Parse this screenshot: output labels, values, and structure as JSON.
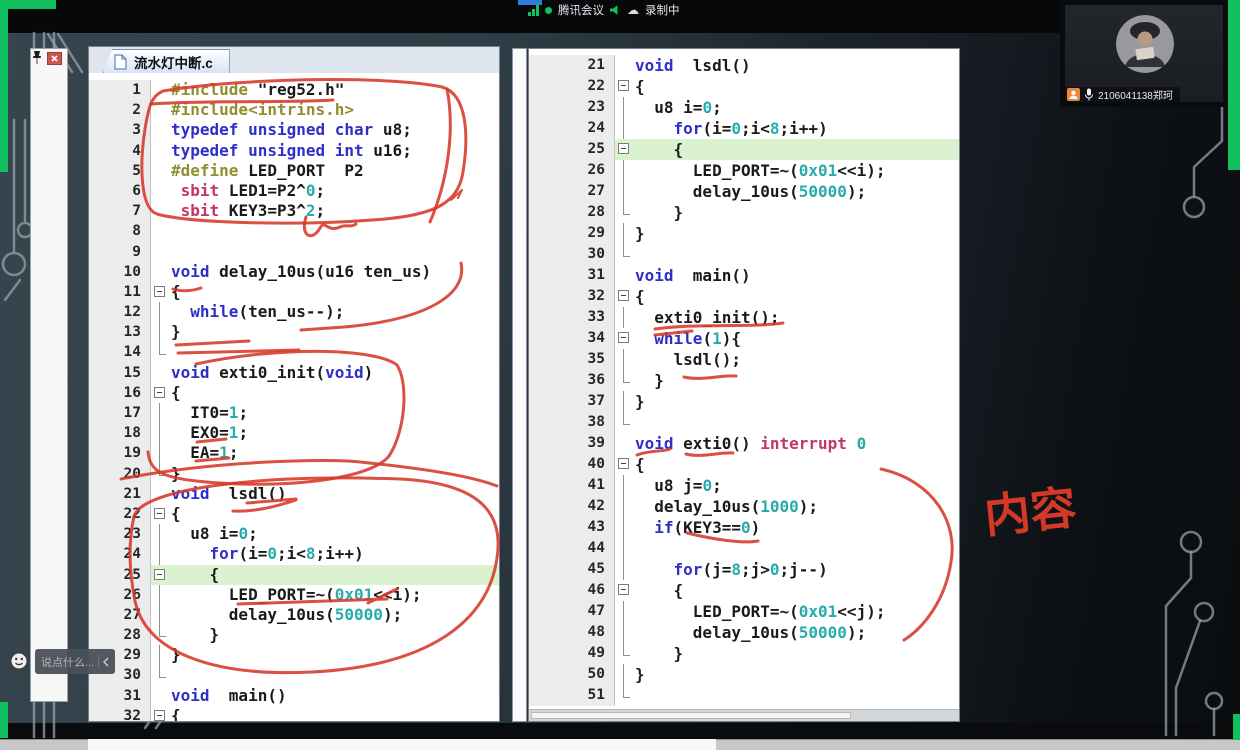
{
  "colors": {
    "green": "#12c05f",
    "pen": "#d63828"
  },
  "meeting": {
    "status_bar": {
      "app_name": "腾讯会议",
      "recording_label": "录制中"
    },
    "participant": {
      "name": "2106041138郑珂"
    },
    "chat": {
      "placeholder": "说点什么..."
    }
  },
  "editor": {
    "tab": {
      "title": "流水灯中断.c"
    },
    "colors": {
      "kw": "#2e2ec8",
      "c51": "#c23565",
      "pre": "#8f8f2f",
      "num": "#2aabab",
      "text": "#1a1a1a",
      "hl": "#daf2cf"
    },
    "left_panel": {
      "lines": [
        {
          "n": 1,
          "fold": "",
          "hl": false,
          "seg": [
            [
              "pre",
              "#include"
            ],
            [
              "txt",
              " \"reg52.h\""
            ]
          ]
        },
        {
          "n": 2,
          "fold": "",
          "hl": false,
          "seg": [
            [
              "pre",
              "#include<intrins.h>"
            ]
          ]
        },
        {
          "n": 3,
          "fold": "",
          "hl": false,
          "seg": [
            [
              "kw",
              "typedef unsigned char"
            ],
            [
              "txt",
              " u8;"
            ]
          ]
        },
        {
          "n": 4,
          "fold": "",
          "hl": false,
          "seg": [
            [
              "kw",
              "typedef unsigned int"
            ],
            [
              "txt",
              " u16;"
            ]
          ]
        },
        {
          "n": 5,
          "fold": "",
          "hl": false,
          "seg": [
            [
              "pre",
              "#define"
            ],
            [
              "txt",
              " LED_PORT  P2"
            ]
          ]
        },
        {
          "n": 6,
          "fold": "",
          "hl": false,
          "seg": [
            [
              "txt",
              " "
            ],
            [
              "c51",
              "sbit"
            ],
            [
              "txt",
              " LED1=P2^"
            ],
            [
              "num",
              "0"
            ],
            [
              "txt",
              ";"
            ]
          ]
        },
        {
          "n": 7,
          "fold": "",
          "hl": false,
          "seg": [
            [
              "txt",
              " "
            ],
            [
              "c51",
              "sbit"
            ],
            [
              "txt",
              " KEY3=P3^"
            ],
            [
              "num",
              "2"
            ],
            [
              "txt",
              ";"
            ]
          ]
        },
        {
          "n": 8,
          "fold": "",
          "hl": false,
          "seg": []
        },
        {
          "n": 9,
          "fold": "",
          "hl": false,
          "seg": []
        },
        {
          "n": 10,
          "fold": "",
          "hl": false,
          "seg": [
            [
              "kw",
              "void"
            ],
            [
              "txt",
              " delay_10us(u16 ten_us)"
            ]
          ]
        },
        {
          "n": 11,
          "fold": "s",
          "hl": false,
          "seg": [
            [
              "txt",
              "{"
            ]
          ]
        },
        {
          "n": 12,
          "fold": "v",
          "hl": false,
          "seg": [
            [
              "txt",
              "  "
            ],
            [
              "kw",
              "while"
            ],
            [
              "txt",
              "(ten_us--);"
            ]
          ]
        },
        {
          "n": 13,
          "fold": "v",
          "hl": false,
          "seg": [
            [
              "txt",
              "}"
            ]
          ]
        },
        {
          "n": 14,
          "fold": "e",
          "hl": false,
          "seg": []
        },
        {
          "n": 15,
          "fold": "",
          "hl": false,
          "seg": [
            [
              "kw",
              "void"
            ],
            [
              "txt",
              " exti0_init("
            ],
            [
              "kw",
              "void"
            ],
            [
              "txt",
              ")"
            ]
          ]
        },
        {
          "n": 16,
          "fold": "s",
          "hl": false,
          "seg": [
            [
              "txt",
              "{"
            ]
          ]
        },
        {
          "n": 17,
          "fold": "v",
          "hl": false,
          "seg": [
            [
              "txt",
              "  IT0="
            ],
            [
              "num",
              "1"
            ],
            [
              "txt",
              ";"
            ]
          ]
        },
        {
          "n": 18,
          "fold": "v",
          "hl": false,
          "seg": [
            [
              "txt",
              "  EX0="
            ],
            [
              "num",
              "1"
            ],
            [
              "txt",
              ";"
            ]
          ]
        },
        {
          "n": 19,
          "fold": "v",
          "hl": false,
          "seg": [
            [
              "txt",
              "  EA="
            ],
            [
              "num",
              "1"
            ],
            [
              "txt",
              ";"
            ]
          ]
        },
        {
          "n": 20,
          "fold": "e",
          "hl": false,
          "seg": [
            [
              "txt",
              "}"
            ]
          ]
        },
        {
          "n": 21,
          "fold": "",
          "hl": false,
          "seg": [
            [
              "kw",
              "void"
            ],
            [
              "txt",
              "  lsdl()"
            ]
          ]
        },
        {
          "n": 22,
          "fold": "s",
          "hl": false,
          "seg": [
            [
              "txt",
              "{"
            ]
          ]
        },
        {
          "n": 23,
          "fold": "v",
          "hl": false,
          "seg": [
            [
              "txt",
              "  u8 i="
            ],
            [
              "num",
              "0"
            ],
            [
              "txt",
              ";"
            ]
          ]
        },
        {
          "n": 24,
          "fold": "v",
          "hl": false,
          "seg": [
            [
              "txt",
              "    "
            ],
            [
              "kw",
              "for"
            ],
            [
              "txt",
              "(i="
            ],
            [
              "num",
              "0"
            ],
            [
              "txt",
              ";i<"
            ],
            [
              "num",
              "8"
            ],
            [
              "txt",
              ";i++)"
            ]
          ]
        },
        {
          "n": 25,
          "fold": "s",
          "hl": true,
          "seg": [
            [
              "txt",
              "    {"
            ]
          ]
        },
        {
          "n": 26,
          "fold": "v",
          "hl": false,
          "seg": [
            [
              "txt",
              "      LED_PORT=~("
            ],
            [
              "num",
              "0x01"
            ],
            [
              "txt",
              "<<i);"
            ]
          ]
        },
        {
          "n": 27,
          "fold": "v",
          "hl": false,
          "seg": [
            [
              "txt",
              "      delay_10us("
            ],
            [
              "num",
              "50000"
            ],
            [
              "txt",
              ");"
            ]
          ]
        },
        {
          "n": 28,
          "fold": "e",
          "hl": false,
          "seg": [
            [
              "txt",
              "    }"
            ]
          ]
        },
        {
          "n": 29,
          "fold": "v",
          "hl": false,
          "seg": [
            [
              "txt",
              "}"
            ]
          ]
        },
        {
          "n": 30,
          "fold": "e",
          "hl": false,
          "seg": []
        },
        {
          "n": 31,
          "fold": "",
          "hl": false,
          "seg": [
            [
              "kw",
              "void"
            ],
            [
              "txt",
              "  main()"
            ]
          ]
        },
        {
          "n": 32,
          "fold": "s",
          "hl": false,
          "seg": [
            [
              "txt",
              "{"
            ]
          ]
        }
      ]
    },
    "right_panel": {
      "lines": [
        {
          "n": 21,
          "fold": "",
          "hl": false,
          "seg": [
            [
              "kw",
              "void"
            ],
            [
              "txt",
              "  lsdl()"
            ]
          ]
        },
        {
          "n": 22,
          "fold": "s",
          "hl": false,
          "seg": [
            [
              "txt",
              "{"
            ]
          ]
        },
        {
          "n": 23,
          "fold": "v",
          "hl": false,
          "seg": [
            [
              "txt",
              "  u8 i="
            ],
            [
              "num",
              "0"
            ],
            [
              "txt",
              ";"
            ]
          ]
        },
        {
          "n": 24,
          "fold": "v",
          "hl": false,
          "seg": [
            [
              "txt",
              "    "
            ],
            [
              "kw",
              "for"
            ],
            [
              "txt",
              "(i="
            ],
            [
              "num",
              "0"
            ],
            [
              "txt",
              ";i<"
            ],
            [
              "num",
              "8"
            ],
            [
              "txt",
              ";i++)"
            ]
          ]
        },
        {
          "n": 25,
          "fold": "s",
          "hl": true,
          "seg": [
            [
              "txt",
              "    {"
            ]
          ]
        },
        {
          "n": 26,
          "fold": "v",
          "hl": false,
          "seg": [
            [
              "txt",
              "      LED_PORT=~("
            ],
            [
              "num",
              "0x01"
            ],
            [
              "txt",
              "<<i);"
            ]
          ]
        },
        {
          "n": 27,
          "fold": "v",
          "hl": false,
          "seg": [
            [
              "txt",
              "      delay_10us("
            ],
            [
              "num",
              "50000"
            ],
            [
              "txt",
              ");"
            ]
          ]
        },
        {
          "n": 28,
          "fold": "e",
          "hl": false,
          "seg": [
            [
              "txt",
              "    }"
            ]
          ]
        },
        {
          "n": 29,
          "fold": "v",
          "hl": false,
          "seg": [
            [
              "txt",
              "}"
            ]
          ]
        },
        {
          "n": 30,
          "fold": "e",
          "hl": false,
          "seg": []
        },
        {
          "n": 31,
          "fold": "",
          "hl": false,
          "seg": [
            [
              "kw",
              "void"
            ],
            [
              "txt",
              "  main()"
            ]
          ]
        },
        {
          "n": 32,
          "fold": "s",
          "hl": false,
          "seg": [
            [
              "txt",
              "{"
            ]
          ]
        },
        {
          "n": 33,
          "fold": "v",
          "hl": false,
          "seg": [
            [
              "txt",
              "  exti0_init();"
            ]
          ]
        },
        {
          "n": 34,
          "fold": "s",
          "hl": false,
          "seg": [
            [
              "txt",
              "  "
            ],
            [
              "kw",
              "while"
            ],
            [
              "txt",
              "("
            ],
            [
              "num",
              "1"
            ],
            [
              "txt",
              "){"
            ]
          ]
        },
        {
          "n": 35,
          "fold": "v",
          "hl": false,
          "seg": [
            [
              "txt",
              "    lsdl();"
            ]
          ]
        },
        {
          "n": 36,
          "fold": "e",
          "hl": false,
          "seg": [
            [
              "txt",
              "  }"
            ]
          ]
        },
        {
          "n": 37,
          "fold": "v",
          "hl": false,
          "seg": [
            [
              "txt",
              "}"
            ]
          ]
        },
        {
          "n": 38,
          "fold": "e",
          "hl": false,
          "seg": []
        },
        {
          "n": 39,
          "fold": "",
          "hl": false,
          "seg": [
            [
              "kw",
              "void"
            ],
            [
              "txt",
              " exti0() "
            ],
            [
              "c51",
              "interrupt"
            ],
            [
              "txt",
              " "
            ],
            [
              "num",
              "0"
            ]
          ]
        },
        {
          "n": 40,
          "fold": "s",
          "hl": false,
          "seg": [
            [
              "txt",
              "{"
            ]
          ]
        },
        {
          "n": 41,
          "fold": "v",
          "hl": false,
          "seg": [
            [
              "txt",
              "  u8 j="
            ],
            [
              "num",
              "0"
            ],
            [
              "txt",
              ";"
            ]
          ]
        },
        {
          "n": 42,
          "fold": "v",
          "hl": false,
          "seg": [
            [
              "txt",
              "  delay_10us("
            ],
            [
              "num",
              "1000"
            ],
            [
              "txt",
              ");"
            ]
          ]
        },
        {
          "n": 43,
          "fold": "v",
          "hl": false,
          "seg": [
            [
              "txt",
              "  "
            ],
            [
              "kw",
              "if"
            ],
            [
              "txt",
              "(KEY3=="
            ],
            [
              "num",
              "0"
            ],
            [
              "txt",
              ")"
            ]
          ]
        },
        {
          "n": 44,
          "fold": "v",
          "hl": false,
          "seg": []
        },
        {
          "n": 45,
          "fold": "v",
          "hl": false,
          "seg": [
            [
              "txt",
              "    "
            ],
            [
              "kw",
              "for"
            ],
            [
              "txt",
              "(j="
            ],
            [
              "num",
              "8"
            ],
            [
              "txt",
              ";j>"
            ],
            [
              "num",
              "0"
            ],
            [
              "txt",
              ";j--)"
            ]
          ]
        },
        {
          "n": 46,
          "fold": "s",
          "hl": false,
          "seg": [
            [
              "txt",
              "    {"
            ]
          ]
        },
        {
          "n": 47,
          "fold": "v",
          "hl": false,
          "seg": [
            [
              "txt",
              "      LED_PORT=~("
            ],
            [
              "num",
              "0x01"
            ],
            [
              "txt",
              "<<j);"
            ]
          ]
        },
        {
          "n": 48,
          "fold": "v",
          "hl": false,
          "seg": [
            [
              "txt",
              "      delay_10us("
            ],
            [
              "num",
              "50000"
            ],
            [
              "txt",
              ");"
            ]
          ]
        },
        {
          "n": 49,
          "fold": "e",
          "hl": false,
          "seg": [
            [
              "txt",
              "    }"
            ]
          ]
        },
        {
          "n": 50,
          "fold": "v",
          "hl": false,
          "seg": [
            [
              "txt",
              "}"
            ]
          ]
        },
        {
          "n": 51,
          "fold": "e",
          "hl": false,
          "seg": []
        }
      ]
    }
  },
  "annotation": {
    "handwritten_text": "内容"
  }
}
